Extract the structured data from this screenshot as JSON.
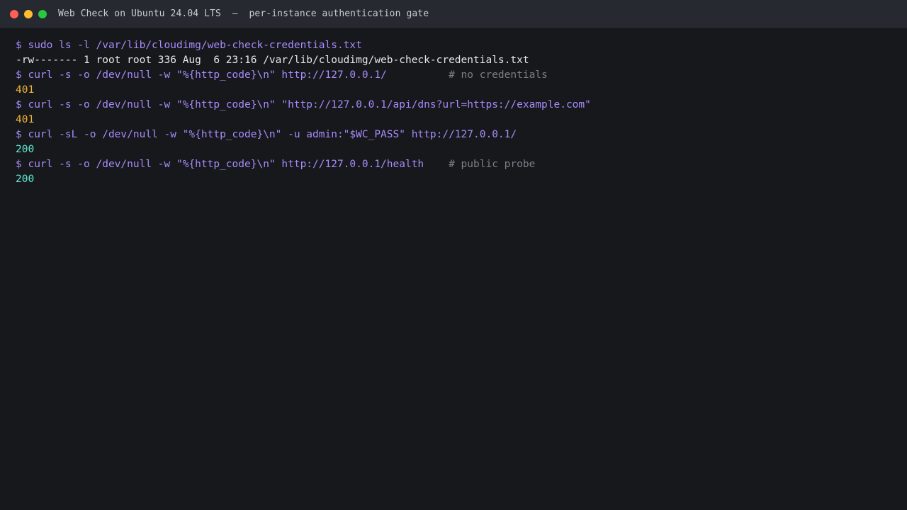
{
  "window": {
    "title": "Web Check on Ubuntu 24.04 LTS  –  per-instance authentication gate"
  },
  "terminal": {
    "lines": [
      {
        "kind": "cmd",
        "text": "$ sudo ls -l /var/lib/cloudimg/web-check-credentials.txt",
        "comment": ""
      },
      {
        "kind": "out",
        "text": "-rw------- 1 root root 336 Aug  6 23:16 /var/lib/cloudimg/web-check-credentials.txt",
        "comment": ""
      },
      {
        "kind": "cmd",
        "text": "$ curl -s -o /dev/null -w \"%{http_code}\\n\" http://127.0.0.1/          ",
        "comment": "# no credentials"
      },
      {
        "kind": "code-401",
        "text": "401",
        "comment": ""
      },
      {
        "kind": "cmd",
        "text": "$ curl -s -o /dev/null -w \"%{http_code}\\n\" \"http://127.0.0.1/api/dns?url=https://example.com\"",
        "comment": ""
      },
      {
        "kind": "code-401",
        "text": "401",
        "comment": ""
      },
      {
        "kind": "cmd",
        "text": "$ curl -sL -o /dev/null -w \"%{http_code}\\n\" -u admin:\"$WC_PASS\" http://127.0.0.1/",
        "comment": ""
      },
      {
        "kind": "code-200",
        "text": "200",
        "comment": ""
      },
      {
        "kind": "cmd",
        "text": "$ curl -s -o /dev/null -w \"%{http_code}\\n\" http://127.0.0.1/health    ",
        "comment": "# public probe"
      },
      {
        "kind": "code-200",
        "text": "200",
        "comment": ""
      }
    ]
  }
}
